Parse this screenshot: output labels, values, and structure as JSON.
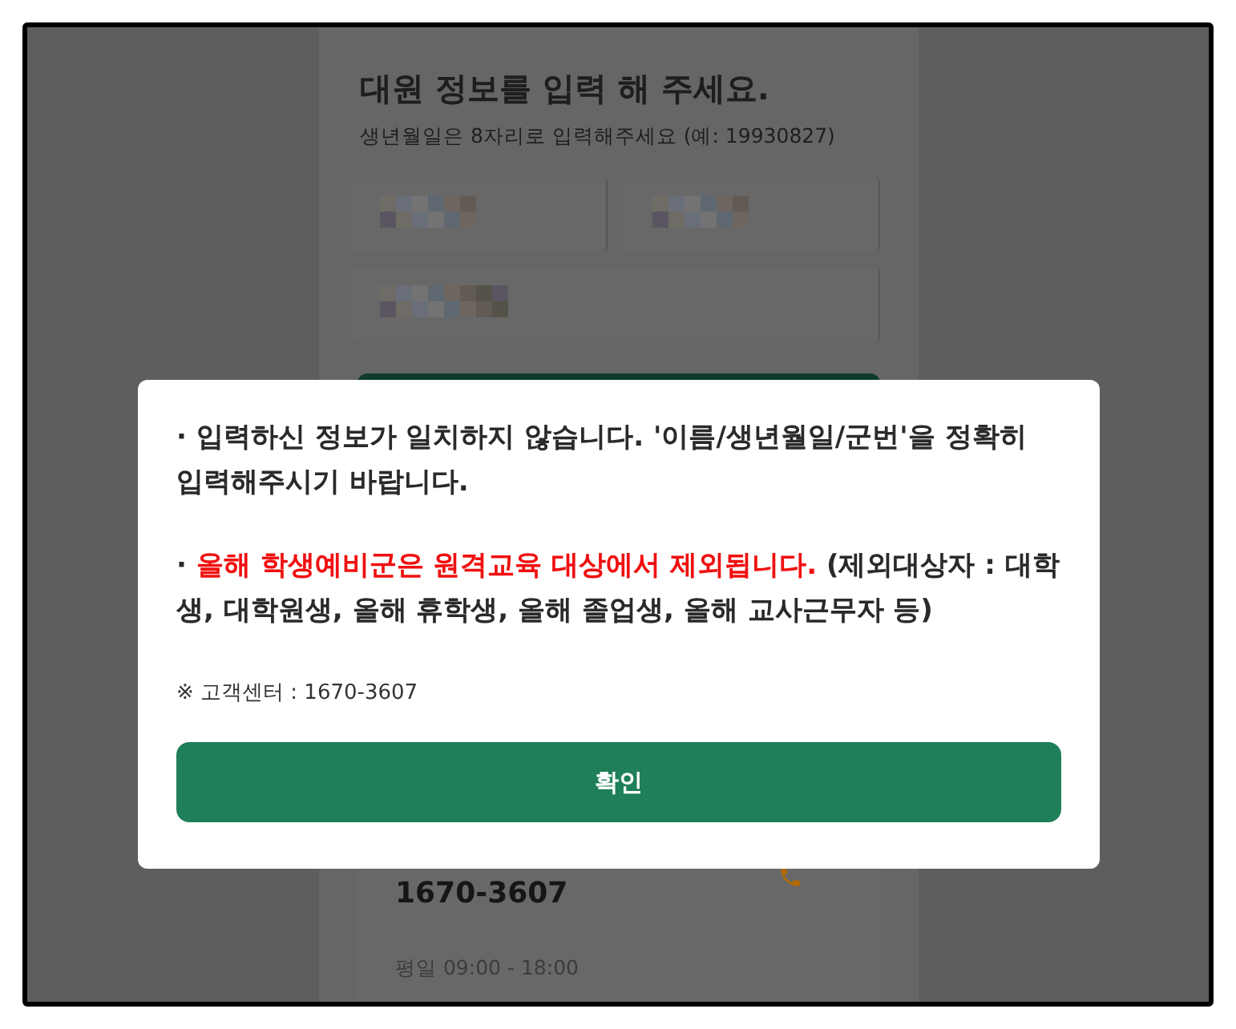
{
  "page": {
    "title": "대원 정보를 입력 해 주세요.",
    "subtitle": "생년월일은 8자리로 입력해주세요 (예: 19930827)",
    "fields": [
      {
        "kind": "half"
      },
      {
        "kind": "half"
      },
      {
        "kind": "full"
      }
    ],
    "contact": {
      "phone": "1670-3607",
      "hours": "평일 09:00 - 18:00"
    }
  },
  "dialog": {
    "messages": [
      {
        "segments": [
          {
            "text": "· 입력하신 정보가 일치하지 않습니다. '이름/생년월일/군번'을 정확히 입력해주시기 바랍니다.",
            "emphasis": false
          }
        ]
      },
      {
        "segments": [
          {
            "text": "· ",
            "emphasis": false
          },
          {
            "text": "올해 학생예비군은 원격교육 대상에서 제외됩니다.",
            "emphasis": true
          },
          {
            "text": " (제외대상자 : 대학생, 대학원생, 올해 휴학생, 올해 졸업생, 올해 교사근무자 등)",
            "emphasis": false
          }
        ]
      }
    ],
    "note": "※ 고객센터 : 1670-3607",
    "confirm_button": "확인"
  }
}
